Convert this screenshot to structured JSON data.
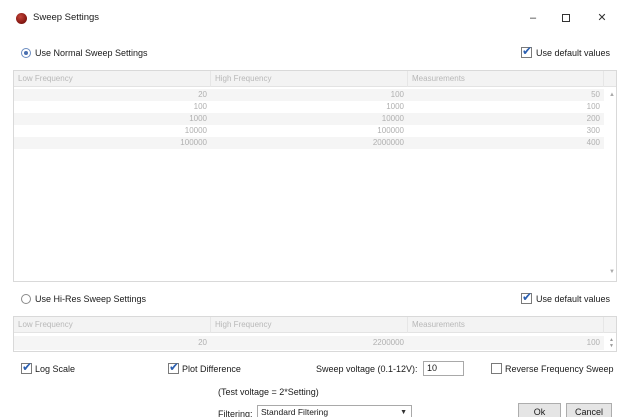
{
  "window": {
    "title": "Sweep Settings",
    "minimize": "–",
    "close": "✕"
  },
  "normal": {
    "radio_label": "Use Normal Sweep Settings",
    "default_label": "Use default values",
    "default_checked": true,
    "selected": true,
    "columns": [
      "Low Frequency",
      "High Frequency",
      "Measurements"
    ],
    "rows": [
      [
        "20",
        "100",
        "50"
      ],
      [
        "100",
        "1000",
        "100"
      ],
      [
        "1000",
        "10000",
        "200"
      ],
      [
        "10000",
        "100000",
        "300"
      ],
      [
        "100000",
        "2000000",
        "400"
      ]
    ]
  },
  "hires": {
    "radio_label": "Use Hi-Res Sweep Settings",
    "default_label": "Use default values",
    "default_checked": true,
    "selected": false,
    "columns": [
      "Low Frequency",
      "High Frequency",
      "Measurements"
    ],
    "rows": [
      [
        "20",
        "2200000",
        "100"
      ]
    ]
  },
  "options": {
    "log_scale_label": "Log Scale",
    "log_scale_checked": true,
    "plot_diff_label": "Plot Difference",
    "plot_diff_checked": true,
    "voltage_label": "Sweep voltage (0.1-12V):",
    "voltage_value": "10",
    "reverse_label": "Reverse Frequency Sweep",
    "reverse_checked": false,
    "test_voltage_note": "(Test voltage = 2*Setting)",
    "filtering_label": "Filtering:",
    "filtering_value": "Standard Filtering"
  },
  "buttons": {
    "ok": "Ok",
    "cancel": "Cancel"
  },
  "icons": {
    "app": "app-logo-icon",
    "minimize": "minimize-icon",
    "maximize": "maximize-icon",
    "close": "close-icon",
    "dropdown": "chevron-down-icon"
  }
}
